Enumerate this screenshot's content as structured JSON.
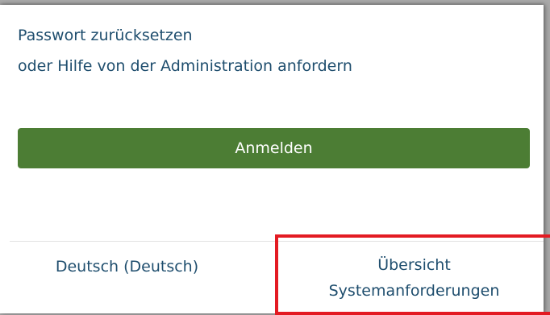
{
  "links": {
    "reset_password": "Passwort zurücksetzen",
    "request_admin_help": "oder Hilfe von der Administration anfordern"
  },
  "login": {
    "button_label": "Anmelden"
  },
  "footer": {
    "language": "Deutsch (Deutsch)",
    "overview": "Übersicht",
    "system_requirements": "Systemanforderungen"
  },
  "colors": {
    "primary_green": "#4c7d34",
    "link_blue": "#1f4e6e",
    "highlight_red": "#e31b23"
  }
}
